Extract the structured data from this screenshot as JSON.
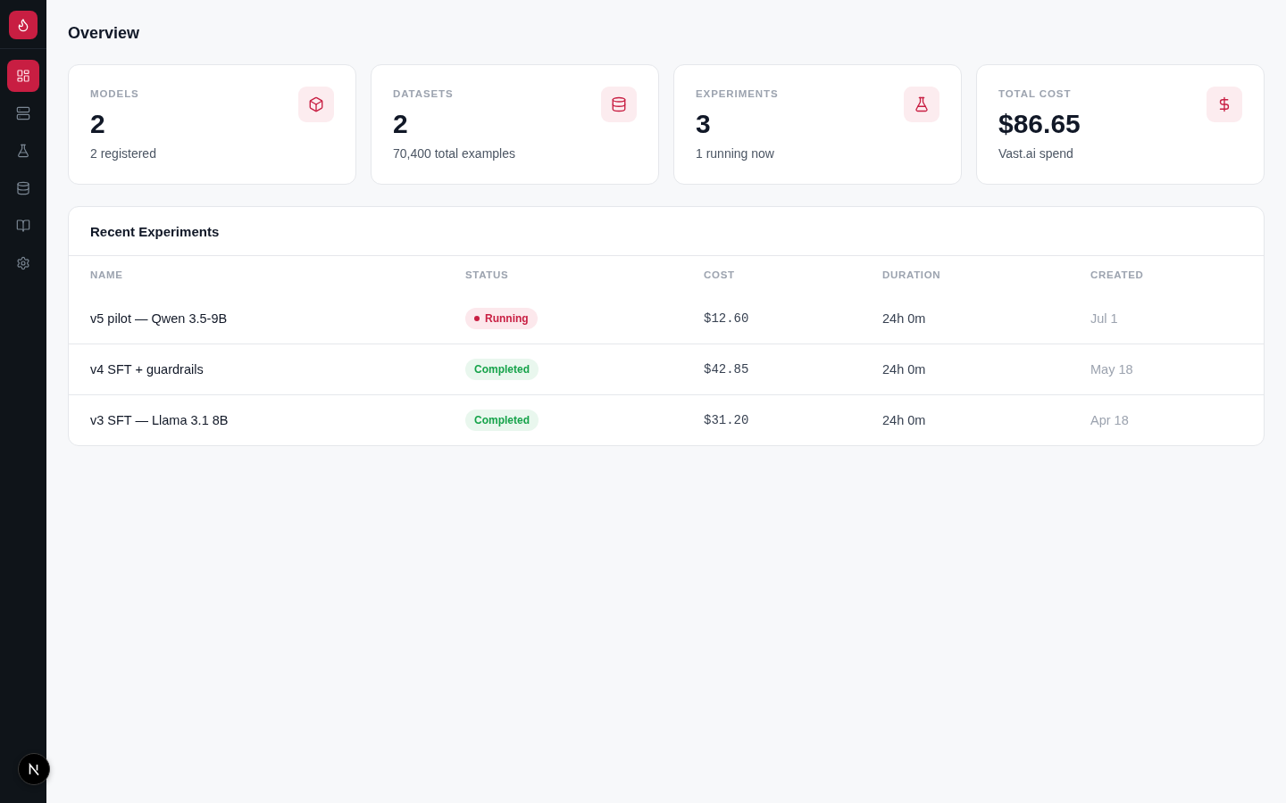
{
  "sidebar": {
    "items": [
      {
        "selected": true
      },
      {
        "selected": false
      },
      {
        "selected": false
      },
      {
        "selected": false
      },
      {
        "selected": false
      },
      {
        "selected": false
      }
    ]
  },
  "page": {
    "title": "Overview"
  },
  "stats": [
    {
      "label": "MODELS",
      "value": "2",
      "caption": "2 registered"
    },
    {
      "label": "DATASETS",
      "value": "2",
      "caption": "70,400 total examples"
    },
    {
      "label": "EXPERIMENTS",
      "value": "3",
      "caption": "1 running now"
    },
    {
      "label": "TOTAL COST",
      "value": "$86.65",
      "caption": "Vast.ai spend"
    }
  ],
  "recent_experiments": {
    "title": "Recent Experiments",
    "columns": [
      "NAME",
      "STATUS",
      "COST",
      "DURATION",
      "CREATED"
    ],
    "rows": [
      {
        "name": "v5 pilot — Qwen 3.5-9B",
        "status": {
          "label": "Running",
          "kind": "running"
        },
        "cost": "$12.60",
        "duration": "24h 0m",
        "created": "Jul 1"
      },
      {
        "name": "v4 SFT + guardrails",
        "status": {
          "label": "Completed",
          "kind": "completed"
        },
        "cost": "$42.85",
        "duration": "24h 0m",
        "created": "May 18"
      },
      {
        "name": "v3 SFT — Llama 3.1 8B",
        "status": {
          "label": "Completed",
          "kind": "completed"
        },
        "cost": "$31.20",
        "duration": "24h 0m",
        "created": "Apr 18"
      }
    ]
  }
}
